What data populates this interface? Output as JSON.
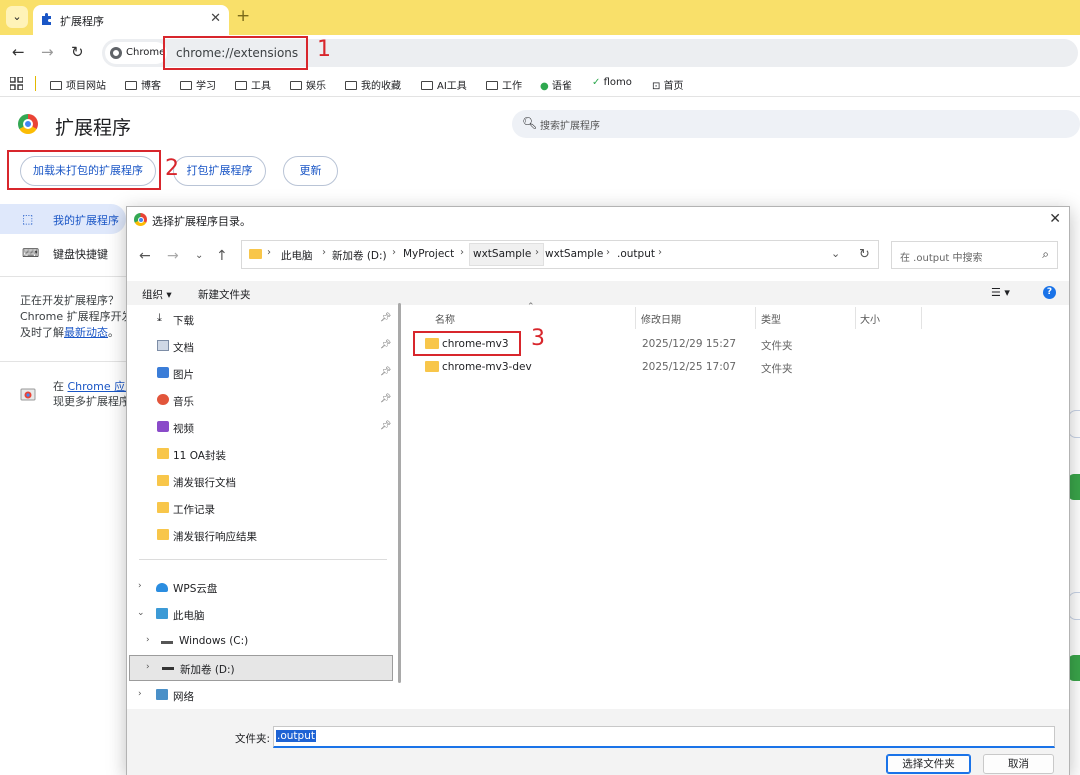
{
  "tab": {
    "title": "扩展程序",
    "close": "✕",
    "new_tab": "+"
  },
  "toolbar": {
    "chip": "Chrome",
    "url": "chrome://extensions"
  },
  "bookmarks": [
    "项目网站",
    "博客",
    "学习",
    "工具",
    "娱乐",
    "我的收藏",
    "AI工具",
    "工作",
    "语雀",
    "flomo",
    "首页"
  ],
  "page": {
    "title": "扩展程序",
    "search_placeholder": "搜索扩展程序",
    "load_unpacked": "加载未打包的扩展程序",
    "pack": "打包扩展程序",
    "update": "更新",
    "side_my_extensions": "我的扩展程序",
    "side_shortcuts": "键盘快捷键",
    "dev_line1": "正在开发扩展程序？",
    "dev_line2": "Chrome 扩展程序开发",
    "dev_line3_prefix": "及时了解",
    "dev_link": "最新动态",
    "dev_line3_suffix": "。",
    "store_prefix": "在 ",
    "store_link": "Chrome 应用",
    "store_line2": "现更多扩展程序"
  },
  "annotations": {
    "n1": "1",
    "n2": "2",
    "n3": "3"
  },
  "dialog": {
    "title": "选择扩展程序目录。",
    "breadcrumbs": [
      "此电脑",
      "新加卷 (D:)",
      "MyProject",
      "wxtSample",
      "wxtSample",
      ".output"
    ],
    "search_placeholder": "在 .output 中搜索",
    "organize": "组织 ▾",
    "new_folder": "新建文件夹",
    "quick_access": [
      "下载",
      "文档",
      "图片",
      "音乐",
      "视频"
    ],
    "folders": [
      "11 OA封装",
      "浦发银行文档",
      "工作记录",
      "浦发银行响应结果"
    ],
    "tree": {
      "wps": "WPS云盘",
      "this_pc": "此电脑",
      "windows": "Windows (C:)",
      "new_volume": "新加卷 (D:)",
      "network": "网络"
    },
    "columns": {
      "name": "名称",
      "date": "修改日期",
      "type": "类型",
      "size": "大小"
    },
    "files": [
      {
        "name": "chrome-mv3",
        "date": "2025/12/29 15:27",
        "type": "文件夹"
      },
      {
        "name": "chrome-mv3-dev",
        "date": "2025/12/25 17:07",
        "type": "文件夹"
      }
    ],
    "folder_label": "文件夹:",
    "folder_value": ".output",
    "select_button": "选择文件夹",
    "cancel_button": "取消"
  },
  "colors": {
    "highlight": "#d8262c",
    "tabstrip": "#f9e06a",
    "accent": "#1a56c6"
  }
}
